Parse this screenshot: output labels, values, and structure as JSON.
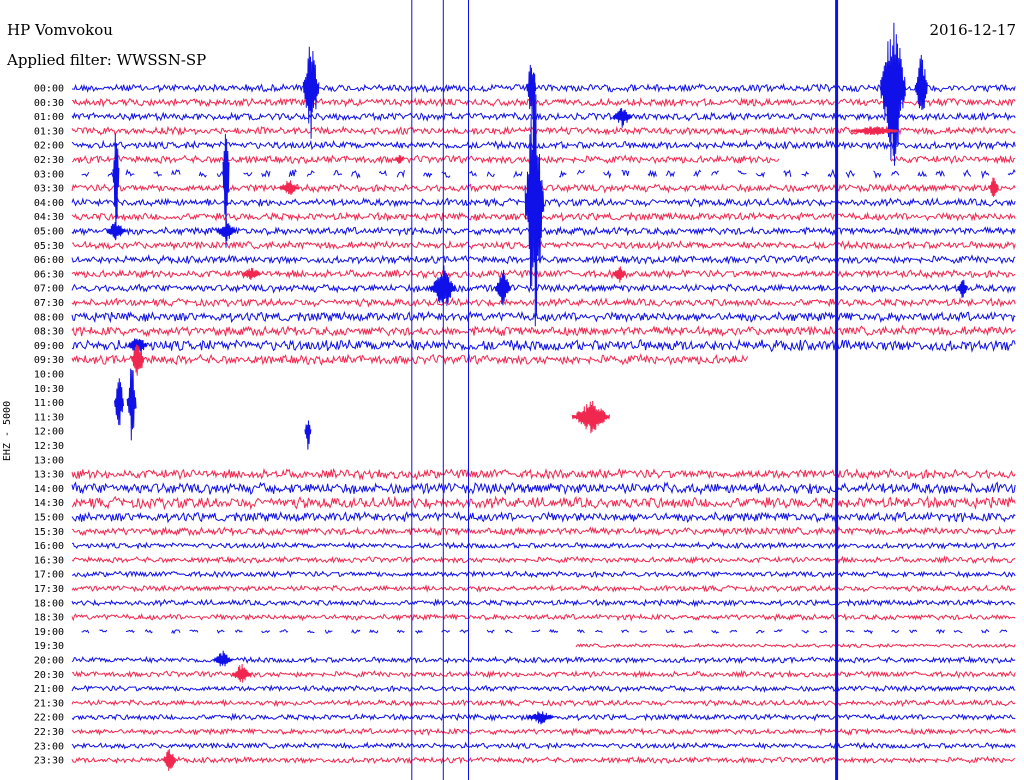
{
  "header": {
    "station": "HP Vomvokou",
    "date": "2016-12-17",
    "filter_label": "Applied filter: WWSSN-SP",
    "channel_label": "EHZ - 5000"
  },
  "colors": {
    "trace_a": "#1010e8",
    "trace_b": "#f0284f",
    "background": "#ffffff",
    "text": "#000000"
  },
  "chart_data": {
    "type": "line",
    "subtype": "helicorder",
    "title": "",
    "xlabel": "",
    "ylabel": "EHZ - 5000",
    "minutes_per_line": 30,
    "time_labels": [
      "00:00",
      "00:30",
      "01:00",
      "01:30",
      "02:00",
      "02:30",
      "03:00",
      "03:30",
      "04:00",
      "04:30",
      "05:00",
      "05:30",
      "06:00",
      "06:30",
      "07:00",
      "07:30",
      "08:00",
      "08:30",
      "09:00",
      "09:30",
      "10:00",
      "10:30",
      "11:00",
      "11:30",
      "12:00",
      "12:30",
      "13:00",
      "13:30",
      "14:00",
      "14:30",
      "15:00",
      "15:30",
      "16:00",
      "16:30",
      "17:00",
      "17:30",
      "18:00",
      "18:30",
      "19:00",
      "19:30",
      "20:00",
      "20:30",
      "21:00",
      "21:30",
      "22:00",
      "22:30",
      "23:00",
      "23:30"
    ],
    "row_color_pattern": [
      "trace_a",
      "trace_b"
    ],
    "baseline_amplitude": [
      4,
      4,
      4,
      4,
      4,
      4,
      4,
      4,
      4,
      4,
      4,
      4,
      4,
      4,
      4,
      4,
      5,
      5,
      6,
      5,
      0,
      0,
      0,
      0,
      0,
      0,
      0,
      5,
      6,
      6,
      5,
      4,
      3,
      3,
      3,
      3,
      3,
      3,
      2,
      2,
      3,
      3,
      3,
      3,
      3,
      3,
      3,
      3
    ],
    "data_gaps": [
      {
        "line": 5,
        "from_min": 22.5,
        "to_min": 26
      },
      {
        "line": 6,
        "from_min": 0,
        "to_min": 30,
        "pattern": "intermittent"
      },
      {
        "line": 19,
        "from_min": 21.5,
        "to_min": 30
      },
      {
        "line": 20,
        "from_min": 0,
        "to_min": 30
      },
      {
        "line": 21,
        "from_min": 0,
        "to_min": 30
      },
      {
        "line": 22,
        "from_min": 0,
        "to_min": 30
      },
      {
        "line": 23,
        "from_min": 0,
        "to_min": 30
      },
      {
        "line": 24,
        "from_min": 0,
        "to_min": 30
      },
      {
        "line": 25,
        "from_min": 0,
        "to_min": 30,
        "pattern": "intermittent"
      },
      {
        "line": 26,
        "from_min": 0,
        "to_min": 30,
        "pattern": "intermittent"
      },
      {
        "line": 38,
        "from_min": 0,
        "to_min": 30,
        "pattern": "intermittent"
      },
      {
        "line": 39,
        "from_min": 0,
        "to_min": 16
      }
    ],
    "events": [
      {
        "line": 0,
        "minute": 7.6,
        "amplitude": 55,
        "duration_min": 0.5
      },
      {
        "line": 0,
        "minute": 14.6,
        "amplitude": 40,
        "duration_min": 0.3
      },
      {
        "line": 0,
        "minute": 26.1,
        "amplitude": 90,
        "duration_min": 0.8
      },
      {
        "line": 0,
        "minute": 27.0,
        "amplitude": 40,
        "duration_min": 0.4
      },
      {
        "line": 2,
        "minute": 17.5,
        "amplitude": 12,
        "duration_min": 0.6
      },
      {
        "line": 3,
        "minute": 25.5,
        "amplitude": 6,
        "duration_min": 1.5
      },
      {
        "line": 5,
        "minute": 10.4,
        "amplitude": 6,
        "duration_min": 0.3
      },
      {
        "line": 6,
        "minute": 1.4,
        "amplitude": 70,
        "duration_min": 0.2
      },
      {
        "line": 6,
        "minute": 4.9,
        "amplitude": 85,
        "duration_min": 0.2
      },
      {
        "line": 7,
        "minute": 6.9,
        "amplitude": 10,
        "duration_min": 0.6
      },
      {
        "line": 7,
        "minute": 29.3,
        "amplitude": 15,
        "duration_min": 0.3
      },
      {
        "line": 8,
        "minute": 14.7,
        "amplitude": 150,
        "duration_min": 0.6
      },
      {
        "line": 10,
        "minute": 1.4,
        "amplitude": 12,
        "duration_min": 0.6
      },
      {
        "line": 10,
        "minute": 4.9,
        "amplitude": 12,
        "duration_min": 0.6
      },
      {
        "line": 13,
        "minute": 5.7,
        "amplitude": 7,
        "duration_min": 0.6
      },
      {
        "line": 13,
        "minute": 17.4,
        "amplitude": 10,
        "duration_min": 0.4
      },
      {
        "line": 14,
        "minute": 11.8,
        "amplitude": 25,
        "duration_min": 0.8
      },
      {
        "line": 14,
        "minute": 13.7,
        "amplitude": 20,
        "duration_min": 0.5
      },
      {
        "line": 14,
        "minute": 28.3,
        "amplitude": 15,
        "duration_min": 0.3
      },
      {
        "line": 18,
        "minute": 2.1,
        "amplitude": 12,
        "duration_min": 0.6
      },
      {
        "line": 19,
        "minute": 2.1,
        "amplitude": 25,
        "duration_min": 0.4
      },
      {
        "line": 22,
        "minute": 1.5,
        "amplitude": 35,
        "duration_min": 0.3
      },
      {
        "line": 22,
        "minute": 1.9,
        "amplitude": 45,
        "duration_min": 0.3
      },
      {
        "line": 23,
        "minute": 16.5,
        "amplitude": 18,
        "duration_min": 1.2
      },
      {
        "line": 24,
        "minute": 7.5,
        "amplitude": 20,
        "duration_min": 0.2
      },
      {
        "line": 40,
        "minute": 4.8,
        "amplitude": 10,
        "duration_min": 0.6
      },
      {
        "line": 41,
        "minute": 5.4,
        "amplitude": 12,
        "duration_min": 0.6
      },
      {
        "line": 44,
        "minute": 14.9,
        "amplitude": 8,
        "duration_min": 0.8
      },
      {
        "line": 47,
        "minute": 3.1,
        "amplitude": 15,
        "duration_min": 0.4
      }
    ],
    "spanning_traces": [
      {
        "minute": 10.8,
        "from_line": 0,
        "to_line": 47
      },
      {
        "minute": 11.8,
        "from_line": 0,
        "to_line": 47
      },
      {
        "minute": 12.6,
        "from_line": 0,
        "to_line": 47
      },
      {
        "minute": 24.3,
        "from_line": 0,
        "to_line": 47
      }
    ]
  }
}
